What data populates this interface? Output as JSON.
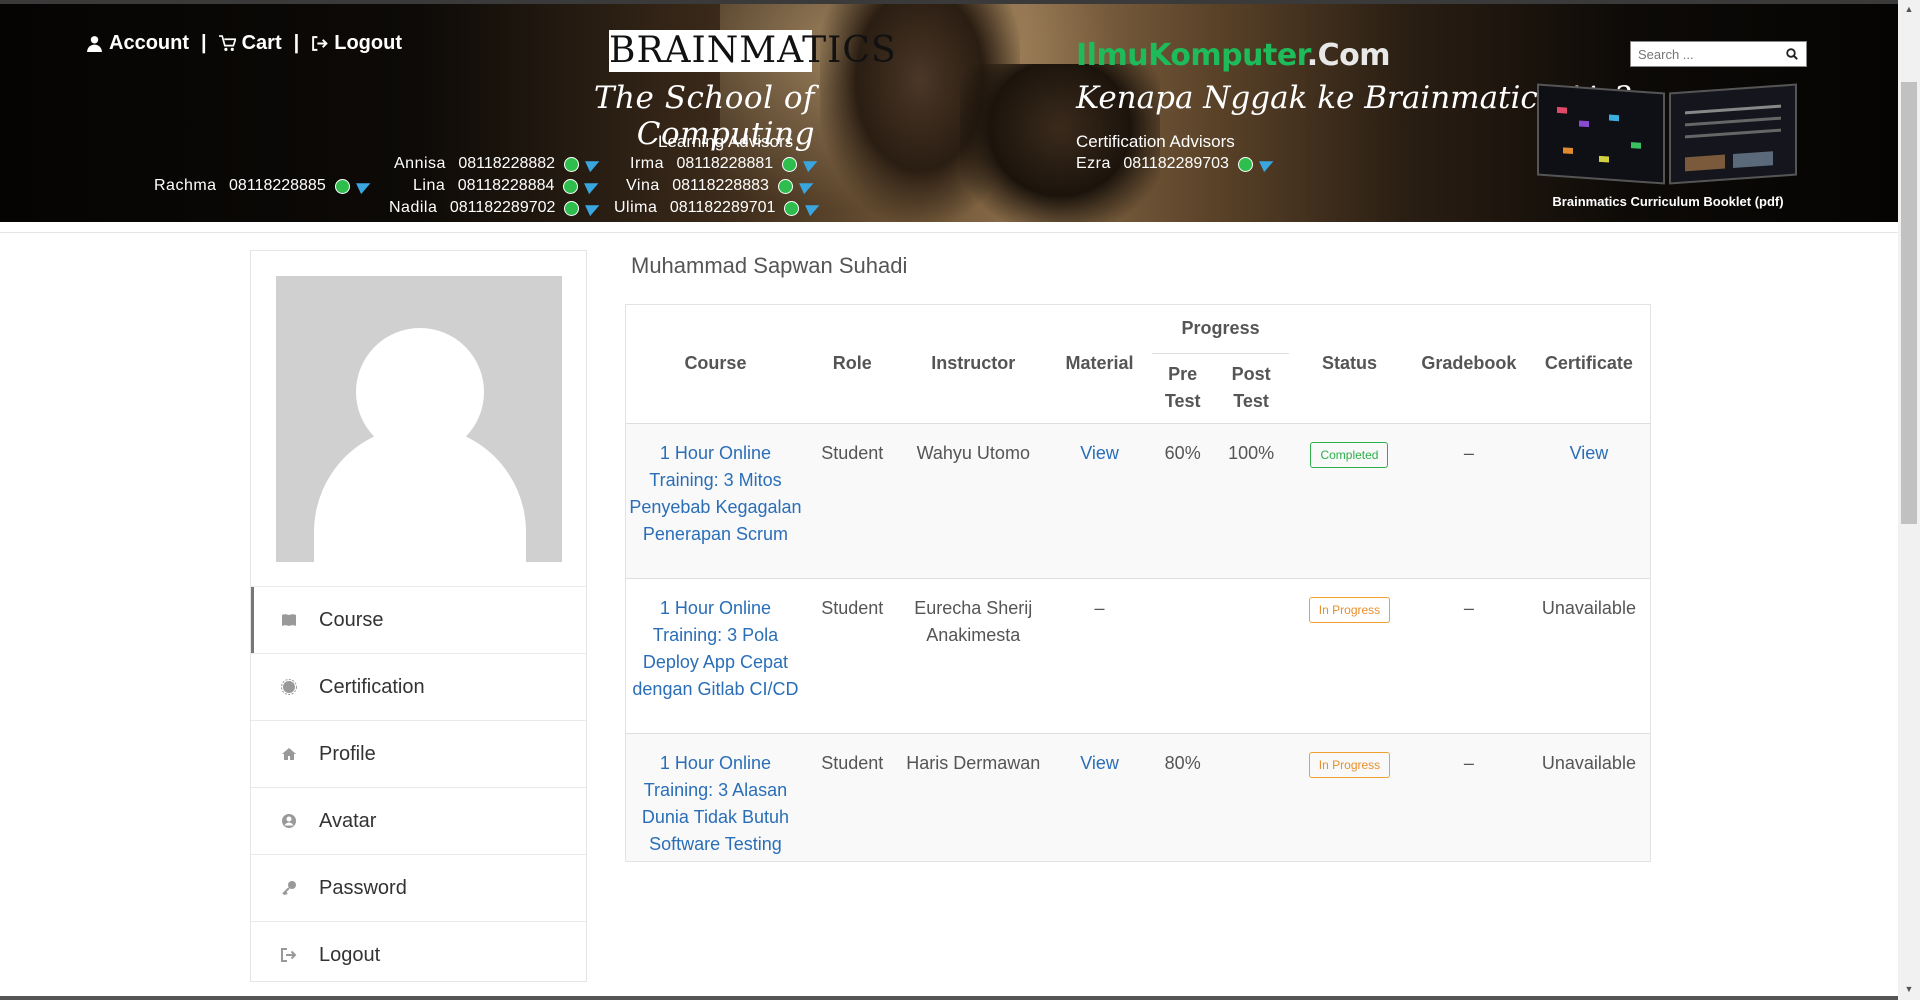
{
  "header": {
    "nav": {
      "account": "Account",
      "cart": "Cart",
      "logout": "Logout",
      "separator": "|"
    },
    "brand_logo": "BRAINMATICS",
    "tagline": "The School of Computing",
    "learning_advisors_title": "Learning Advisors",
    "learning_advisors": [
      {
        "name": "Rachma",
        "phone": "08118228885"
      },
      {
        "name": "Annisa",
        "phone": "08118228882"
      },
      {
        "name": "Lina",
        "phone": "08118228884"
      },
      {
        "name": "Nadila",
        "phone": "081182289702"
      },
      {
        "name": "Irma",
        "phone": "08118228881"
      },
      {
        "name": "Vina",
        "phone": "08118228883"
      },
      {
        "name": "Ulima",
        "phone": "081182289701"
      }
    ],
    "ilmu_brand_green": "IlmuKomputer",
    "ilmu_brand_suffix": ".Com",
    "slogan": "Kenapa Nggak ke Brainmatics Aja?",
    "certification_advisors_title": "Certification Advisors",
    "certification_advisors": [
      {
        "name": "Ezra",
        "phone": "081182289703"
      }
    ],
    "search": {
      "placeholder": "Search ..."
    },
    "booklet_label": "Brainmatics Curriculum Booklet (pdf)"
  },
  "sidebar": {
    "items": [
      {
        "label": "Course",
        "icon": "book-icon",
        "active": true
      },
      {
        "label": "Certification",
        "icon": "certificate-icon",
        "active": false
      },
      {
        "label": "Profile",
        "icon": "home-icon",
        "active": false
      },
      {
        "label": "Avatar",
        "icon": "user-circle-icon",
        "active": false
      },
      {
        "label": "Password",
        "icon": "key-icon",
        "active": false
      },
      {
        "label": "Logout",
        "icon": "sign-out-icon",
        "active": false
      }
    ]
  },
  "main": {
    "user_name": "Muhammad Sapwan Suhadi",
    "table": {
      "headers": {
        "course": "Course",
        "role": "Role",
        "instructor": "Instructor",
        "material": "Material",
        "progress": "Progress",
        "pre_test": "Pre Test",
        "post_test": "Post Test",
        "status": "Status",
        "gradebook": "Gradebook",
        "certificate": "Certificate"
      },
      "rows": [
        {
          "course": "1 Hour Online Training: 3 Mitos Penyebab Kegagalan Penerapan Scrum",
          "role": "Student",
          "instructor": "Wahyu Utomo",
          "material": "View",
          "pre_test": "60%",
          "post_test": "100%",
          "status": "Completed",
          "gradebook": "–",
          "certificate": "View"
        },
        {
          "course": "1 Hour Online Training: 3 Pola Deploy App Cepat dengan Gitlab CI/CD",
          "role": "Student",
          "instructor": "Eurecha Sherij Anakimesta",
          "material": "–",
          "pre_test": "",
          "post_test": "",
          "status": "In Progress",
          "gradebook": "–",
          "certificate": "Unavailable"
        },
        {
          "course": "1 Hour Online Training: 3 Alasan Dunia Tidak Butuh Software Testing",
          "role": "Student",
          "instructor": "Haris Dermawan",
          "material": "View",
          "pre_test": "80%",
          "post_test": "",
          "status": "In Progress",
          "gradebook": "–",
          "certificate": "Unavailable"
        }
      ]
    }
  },
  "colors": {
    "link": "#2a6eb8",
    "badge_completed": "#2fae4e",
    "badge_in_progress": "#e8902a",
    "ilmu_green": "#1ebb5b",
    "whatsapp": "#2fbe4d",
    "telegram": "#3aa6e0"
  }
}
